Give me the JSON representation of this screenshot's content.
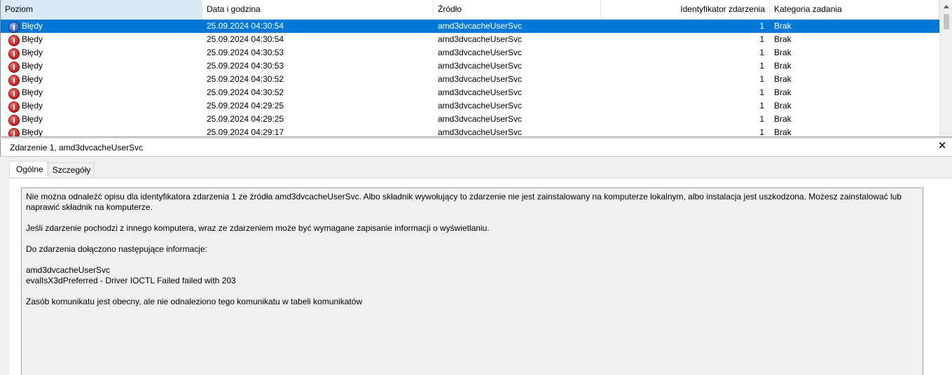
{
  "columns": {
    "level": "Poziom",
    "datetime": "Data i godzina",
    "source": "Źródło",
    "event_id": "Identyfikator zdarzenia",
    "category": "Kategoria zadania"
  },
  "events": [
    {
      "level": "Błędy",
      "datetime": "25.09.2024 04:30:54",
      "source": "amd3dvcacheUserSvc",
      "event_id": "1",
      "category": "Brak",
      "selected": true
    },
    {
      "level": "Błędy",
      "datetime": "25.09.2024 04:30:54",
      "source": "amd3dvcacheUserSvc",
      "event_id": "1",
      "category": "Brak"
    },
    {
      "level": "Błędy",
      "datetime": "25.09.2024 04:30:53",
      "source": "amd3dvcacheUserSvc",
      "event_id": "1",
      "category": "Brak"
    },
    {
      "level": "Błędy",
      "datetime": "25.09.2024 04:30:53",
      "source": "amd3dvcacheUserSvc",
      "event_id": "1",
      "category": "Brak"
    },
    {
      "level": "Błędy",
      "datetime": "25.09.2024 04:30:52",
      "source": "amd3dvcacheUserSvc",
      "event_id": "1",
      "category": "Brak"
    },
    {
      "level": "Błędy",
      "datetime": "25.09.2024 04:30:52",
      "source": "amd3dvcacheUserSvc",
      "event_id": "1",
      "category": "Brak"
    },
    {
      "level": "Błędy",
      "datetime": "25.09.2024 04:29:25",
      "source": "amd3dvcacheUserSvc",
      "event_id": "1",
      "category": "Brak"
    },
    {
      "level": "Błędy",
      "datetime": "25.09.2024 04:29:25",
      "source": "amd3dvcacheUserSvc",
      "event_id": "1",
      "category": "Brak"
    },
    {
      "level": "Błędy",
      "datetime": "25.09.2024 04:29:17",
      "source": "amd3dvcacheUserSvc",
      "event_id": "1",
      "category": "Brak"
    }
  ],
  "detail": {
    "title": "Zdarzenie 1, amd3dvcacheUserSvc",
    "close_glyph": "✕",
    "tabs": [
      {
        "label": "Ogólne",
        "active": true
      },
      {
        "label": "Szczegóły",
        "active": false
      }
    ],
    "description": [
      "Nie można odnaleźć opisu dla identyfikatora zdarzenia 1 ze źródła amd3dvcacheUserSvc. Albo składnik wywołujący to zdarzenie nie jest zainstalowany na komputerze lokalnym, albo instalacja jest uszkodzona. Możesz zainstalować lub naprawić składnik na komputerze.",
      "",
      "Jeśli zdarzenie pochodzi z innego komputera, wraz ze zdarzeniem może być wymagane zapisanie informacji o wyświetlaniu.",
      "",
      "Do zdarzenia dołączono następujące informacje:",
      "",
      "amd3dvcacheUserSvc",
      "evalIsX3dPreferred - Driver IOCTL Failed failed with 203",
      "",
      "Zasób komunikatu jest obecny, ale nie odnaleziono tego komunikatu w tabeli komunikatów"
    ]
  },
  "colors": {
    "selection": "#0078d7",
    "sorted_header": "#d9ebf9",
    "error_icon": "#d32b2b"
  }
}
